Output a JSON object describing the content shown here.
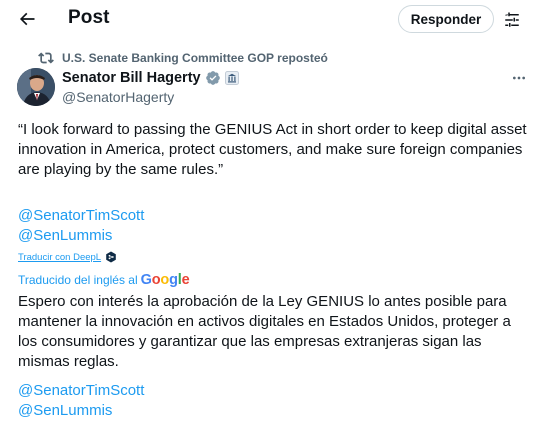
{
  "header": {
    "title": "Post",
    "back_icon": "arrow-left-icon",
    "reply_label": "Responder",
    "tune_icon": "sliders-icon"
  },
  "repost": {
    "icon": "repost-icon",
    "text": "U.S. Senate Banking Committee GOP reposteó"
  },
  "author": {
    "name": "Senator Bill Hagerty",
    "handle": "@SenatorHagerty",
    "verified_color": "#829aab"
  },
  "post": {
    "text": "“I look forward to passing the GENIUS Act in short order to keep digital asset innovation in America, protect customers, and make sure foreign companies are playing by the same rules.”",
    "mentions": [
      "@SenatorTimScott",
      "@SenLummis"
    ]
  },
  "translation": {
    "link_label": "Traducir con DeepL",
    "translated_by": "Traducido del inglés al",
    "google_letters": [
      "G",
      "o",
      "o",
      "g",
      "l",
      "e"
    ],
    "text": "Espero con interés la aprobación de la Ley GENIUS lo antes posible para mantener la innovación en activos digitales en Estados Unidos, proteger a los consumidores y garantizar que las empresas extranjeras sigan las mismas reglas.",
    "mentions": [
      "@SenatorTimScott",
      "@SenLummis"
    ]
  },
  "colors": {
    "link": "#1d9bf0",
    "secondary_text": "#536471",
    "primary_text": "#0f1419"
  }
}
